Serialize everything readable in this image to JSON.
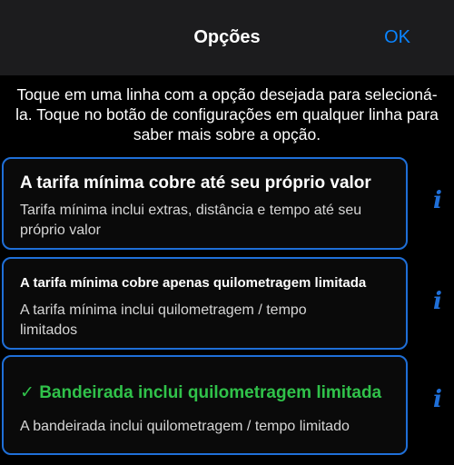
{
  "navbar": {
    "title": "Opções",
    "ok_label": "OK"
  },
  "instructions": "Toque em uma linha com a opção desejada para selecioná-la. Toque no botão de configurações em qualquer linha para saber mais sobre a opção.",
  "options": [
    {
      "title": "A tarifa mínima cobre até seu próprio valor",
      "description": "Tarifa mínima inclui extras, distância e tempo até seu próprio valor",
      "selected": false,
      "info_icon": "info-icon"
    },
    {
      "title": "A tarifa mínima cobre apenas quilometragem limitada",
      "description": "A tarifa mínima inclui quilometragem / tempo limitados",
      "selected": false,
      "info_icon": "info-icon"
    },
    {
      "title": "✓ Bandeirada inclui quilometragem limitada",
      "description": "A bandeirada inclui quilometragem / tempo limitado",
      "selected": true,
      "info_icon": "info-icon"
    }
  ],
  "colors": {
    "accent": "#0a84ff",
    "border": "#1f6fd8",
    "selected_text": "#30c24a",
    "background": "#000000",
    "navbar": "#1c1c1e"
  }
}
